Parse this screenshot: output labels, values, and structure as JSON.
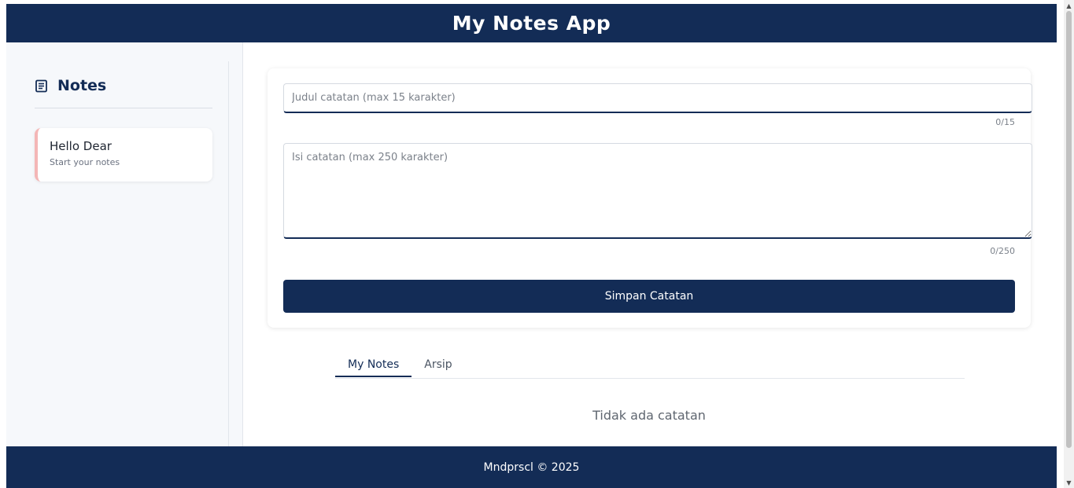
{
  "header": {
    "title": "My Notes App"
  },
  "sidebar": {
    "heading": "Notes",
    "notes": [
      {
        "title": "Hello Dear",
        "subtitle": "Start your notes"
      }
    ]
  },
  "form": {
    "title_placeholder": "Judul catatan (max 15 karakter)",
    "title_value": "",
    "title_counter": "0/15",
    "body_placeholder": "Isi catatan (max 250 karakter)",
    "body_value": "",
    "body_counter": "0/250",
    "save_label": "Simpan Catatan"
  },
  "tabs": [
    {
      "label": "My Notes",
      "active": true
    },
    {
      "label": "Arsip",
      "active": false
    }
  ],
  "empty_message": "Tidak ada catatan",
  "footer": {
    "text": "Mndprscl © 2025"
  },
  "colors": {
    "primary": "#132c56",
    "note_accent": "#f4b6b6",
    "sidebar_bg": "#f6f8fb"
  },
  "icons": {
    "notes_heading": "notes-list-icon"
  }
}
